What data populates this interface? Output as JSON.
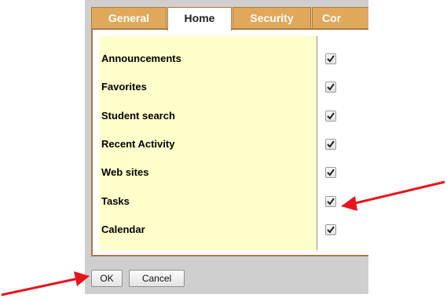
{
  "tabs": [
    {
      "label": "General",
      "active": false
    },
    {
      "label": "Home",
      "active": true
    },
    {
      "label": "Security",
      "active": false
    },
    {
      "label": "Cor",
      "active": false
    }
  ],
  "home_items": [
    {
      "label": "Announcements",
      "checked": true
    },
    {
      "label": "Favorites",
      "checked": true
    },
    {
      "label": "Student search",
      "checked": true
    },
    {
      "label": "Recent Activity",
      "checked": true
    },
    {
      "label": "Web sites",
      "checked": true
    },
    {
      "label": "Tasks",
      "checked": true
    },
    {
      "label": "Calendar",
      "checked": true
    }
  ],
  "buttons": {
    "ok_label": "OK",
    "cancel_label": "Cancel"
  },
  "colors": {
    "tab_inactive": "#e0a85a",
    "panel_border": "#a77a46",
    "list_background": "#ffffcc",
    "annotation_arrow": "#e8141b"
  }
}
